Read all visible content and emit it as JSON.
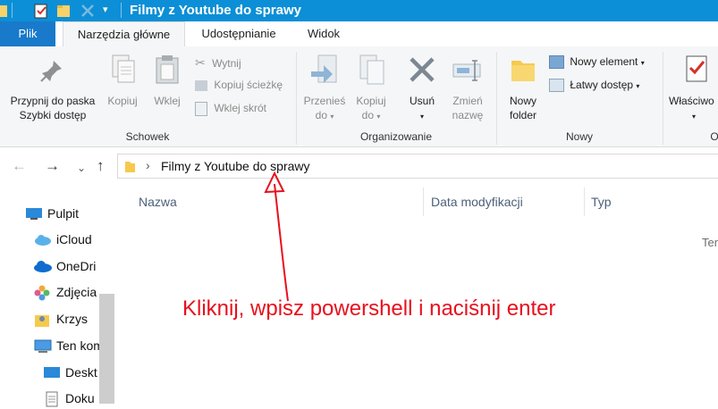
{
  "window": {
    "title": "Filmy z Youtube do sprawy"
  },
  "tabs": [
    {
      "label": "Plik"
    },
    {
      "label": "Narzędzia główne"
    },
    {
      "label": "Udostępnianie"
    },
    {
      "label": "Widok"
    }
  ],
  "ribbon": {
    "schowek": {
      "label": "Schowek",
      "pin_line1": "Przypnij do paska",
      "pin_line2": "Szybki dostęp",
      "copy": "Kopiuj",
      "paste": "Wklej",
      "cut": "Wytnij",
      "copy_path": "Kopiuj ścieżkę",
      "paste_shortcut": "Wklej skrót"
    },
    "organizowanie": {
      "label": "Organizowanie",
      "move_line1": "Przenieś",
      "move_line2": "do",
      "copyto_line1": "Kopiuj",
      "copyto_line2": "do",
      "delete": "Usuń",
      "rename_line1": "Zmień",
      "rename_line2": "nazwę"
    },
    "nowy": {
      "label": "Nowy",
      "folder_line1": "Nowy",
      "folder_line2": "folder",
      "new_item": "Nowy element",
      "easy_access": "Łatwy dostęp"
    },
    "otworz": {
      "label": "O",
      "properties": "Właściwo"
    }
  },
  "address": {
    "path": "Filmy z Youtube do sprawy"
  },
  "navpane": {
    "items": [
      {
        "label": "Pulpit"
      },
      {
        "label": "iCloud"
      },
      {
        "label": "OneDri"
      },
      {
        "label": "Zdjęcia"
      },
      {
        "label": "Krzys"
      },
      {
        "label": "Ten kom"
      },
      {
        "label": "Deskt"
      },
      {
        "label": "Doku"
      }
    ]
  },
  "columns": [
    {
      "label": "Nazwa"
    },
    {
      "label": "Data modyfikacji"
    },
    {
      "label": "Typ"
    }
  ],
  "content": {
    "empty_text": "Ten"
  },
  "annotation": {
    "text": "Kliknij, wpisz powershell i naciśnij enter",
    "color": "#e8101d"
  }
}
